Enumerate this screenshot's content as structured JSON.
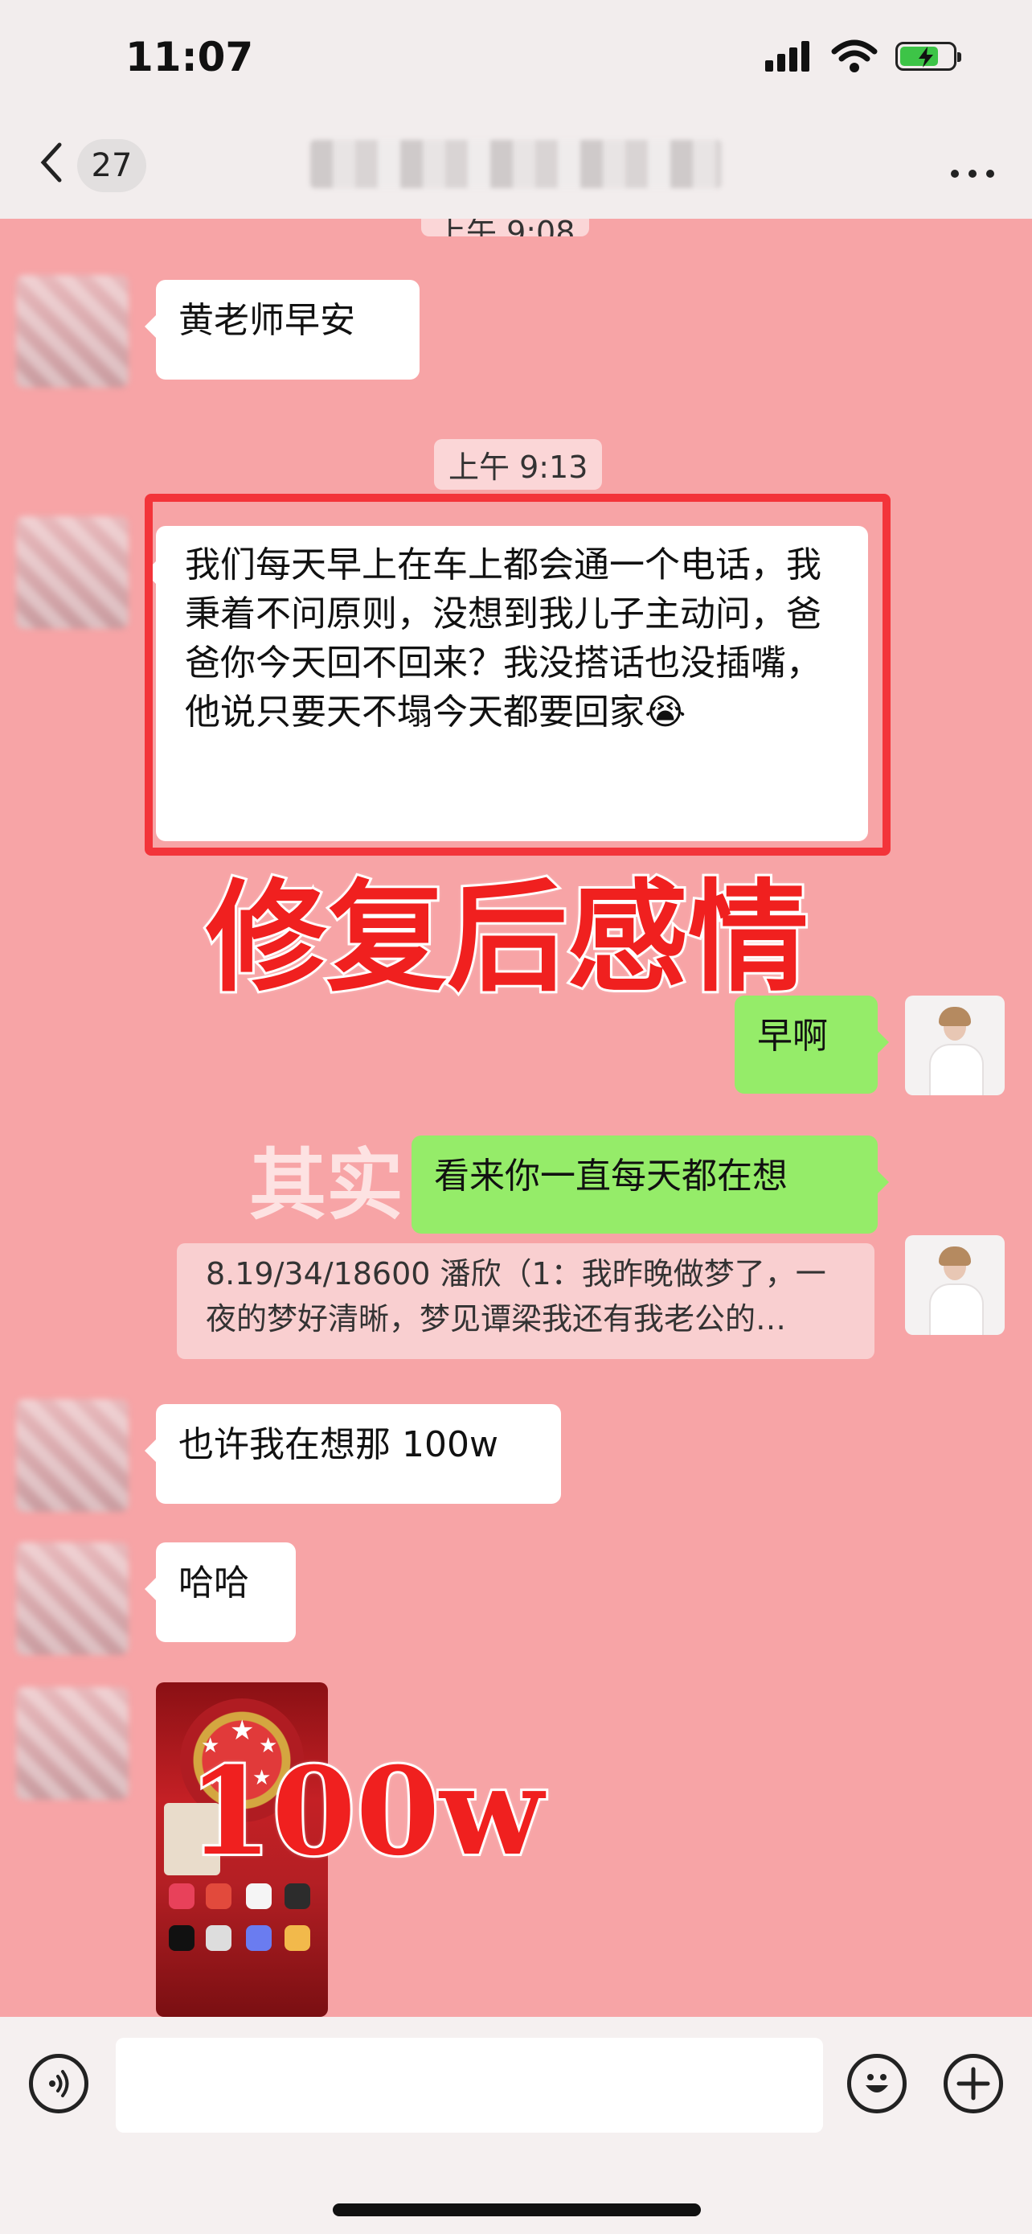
{
  "status_bar": {
    "time": "11:07",
    "signal_icon": "cellular-signal-icon",
    "wifi_icon": "wifi-icon",
    "battery_icon": "battery-charging-icon",
    "battery_level": 0.75,
    "battery_color": "#3dc447"
  },
  "header": {
    "back_icon": "chevron-left-icon",
    "unread_count": "27",
    "more_icon": "more-dots-icon"
  },
  "messages": [
    {
      "timestamp_partial": "上午 9:08"
    },
    {
      "side": "left",
      "text": "黄老师早安"
    },
    {
      "timestamp": "上午 9:13"
    },
    {
      "side": "left",
      "text": "我们每天早上在车上都会通一个电话，我秉着不问原则，没想到我儿子主动问，爸爸你今天回不回来？我没搭话也没插嘴，他说只要天不塌今天都要回家😭"
    },
    {
      "side": "right",
      "text": "早啊"
    },
    {
      "side": "right",
      "text": "看来你一直每天都在想"
    },
    {
      "quote": "8.19/34/18600 潘欣（1：我昨晚做梦了，一夜的梦好清晰，梦见谭梁我还有我老公的…"
    },
    {
      "side": "left",
      "text": "也许我在想那 100w"
    },
    {
      "side": "left",
      "text": "哈哈"
    },
    {
      "side": "left",
      "type": "image"
    }
  ],
  "overlays": {
    "caption_main": "修复后感情",
    "caption_image": "100w",
    "watermark": "其实"
  },
  "colors": {
    "chat_background": "#f7a4a6",
    "my_bubble": "#95ec69",
    "highlight_border": "#f3343a",
    "caption_red": "#f0201f"
  },
  "input_bar": {
    "voice_icon": "voice-input-icon",
    "emoji_icon": "emoji-icon",
    "plus_icon": "plus-icon",
    "input_value": ""
  }
}
